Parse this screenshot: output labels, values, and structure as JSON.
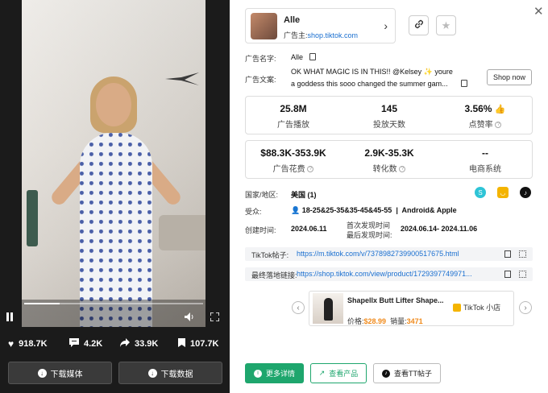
{
  "video": {
    "stats": {
      "likes": "918.7K",
      "comments": "4.2K",
      "shares": "33.9K",
      "saves": "107.7K"
    },
    "download_media_label": "下载媒体",
    "download_data_label": "下载数据",
    "progress_fraction": 0.2
  },
  "advertiser": {
    "name": "Alle",
    "label_prefix": "广告主:",
    "link": "shop.tiktok.com"
  },
  "details": {
    "ad_name_label": "广告名字:",
    "ad_name": "Alle",
    "ad_copy_label": "广告文案:",
    "ad_copy_line1": "OK WHAT MAGIC IS IN THIS!! @Kelsey ✨ youre",
    "ad_copy_line2": "a goddess this sooo changed the summer gam...",
    "shop_now": "Shop now"
  },
  "metrics_row1": [
    {
      "value": "25.8M",
      "label": "广告播放"
    },
    {
      "value": "145",
      "label": "投放天数"
    },
    {
      "value": "3.56%",
      "label": "点赞率"
    }
  ],
  "metrics_row2": [
    {
      "value": "$88.3K-353.9K",
      "label": "广告花费"
    },
    {
      "value": "2.9K-35.3K",
      "label": "转化数"
    },
    {
      "value": "--",
      "label": "电商系统"
    }
  ],
  "info": {
    "region_label": "国家/地区:",
    "region_value": "美国 (1)",
    "audience_label": "受众:",
    "audience_value": "18-25&25-35&35-45&45-55",
    "audience_os": "Android& Apple",
    "created_label": "创建时间:",
    "created_value": "2024.06.11",
    "first_seen_label": "首次发现时间",
    "last_seen_label": "最后发现时间:",
    "seen_range": "2024.06.14- 2024.11.06"
  },
  "links": {
    "tiktok_post_label": "TikTok帖子:",
    "tiktok_post_url": "https://m.tiktok.com/v/7378982739900517675.html",
    "landing_label": "最终落地链接:",
    "landing_url": "https://shop.tiktok.com/view/product/1729397749971..."
  },
  "product": {
    "title": "Shapellx Butt Lifter Shape...",
    "shop": "TikTok 小店",
    "price_label": "价格:",
    "price": "$28.99",
    "sales_label": "销量:",
    "sales": "3471"
  },
  "actions": {
    "more_details": "更多详情",
    "view_product": "查看产品",
    "view_tt_post": "查看TT帖子"
  },
  "colors": {
    "accent_green": "#1ea66d",
    "link_blue": "#1a6fd0",
    "price_orange": "#f08a1b"
  }
}
